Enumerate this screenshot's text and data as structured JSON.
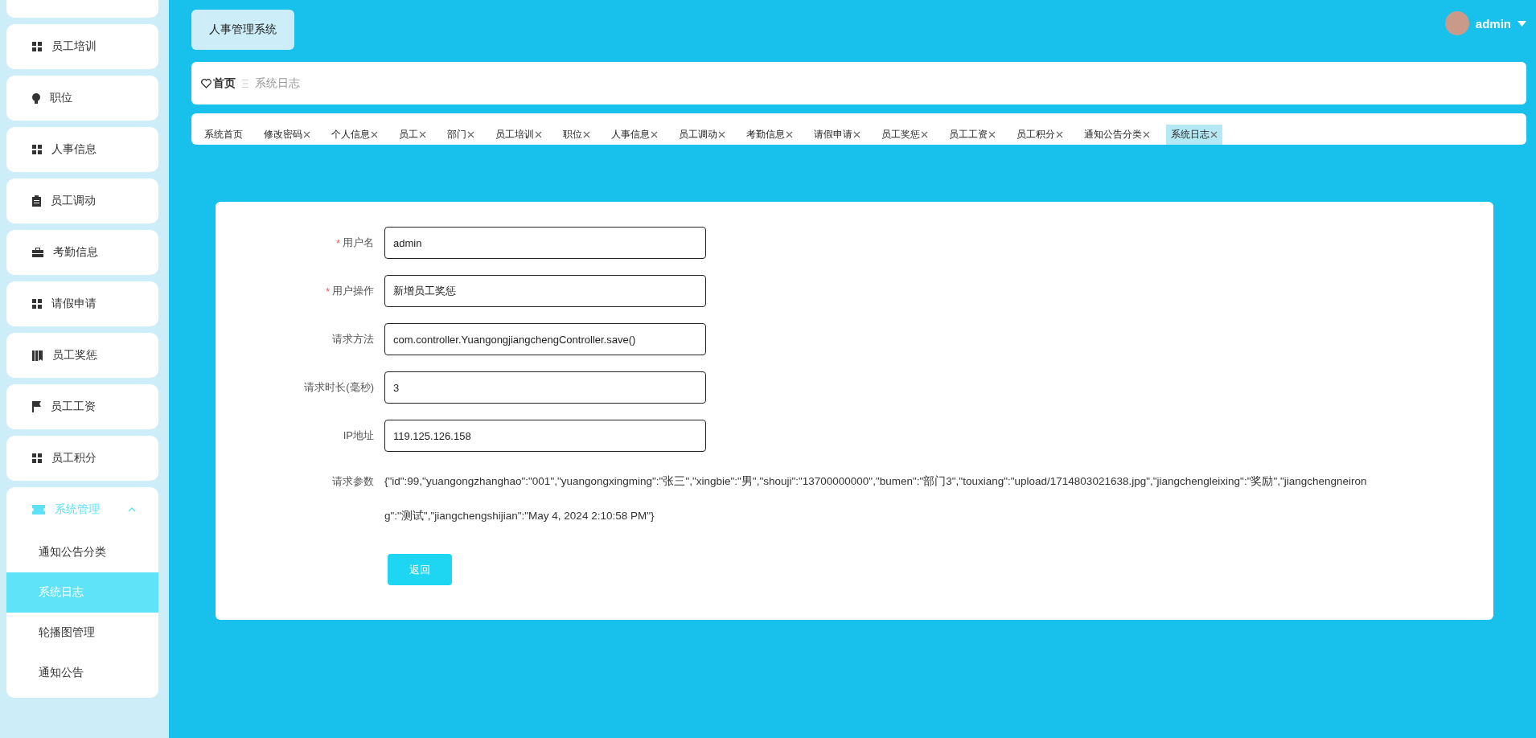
{
  "sidebar": {
    "items": [
      {
        "label": "员工培训",
        "kind": "grid"
      },
      {
        "label": "职位",
        "kind": "bulb"
      },
      {
        "label": "人事信息",
        "kind": "grid"
      },
      {
        "label": "员工调动",
        "kind": "clipboard"
      },
      {
        "label": "考勤信息",
        "kind": "briefcase"
      },
      {
        "label": "请假申请",
        "kind": "grid"
      },
      {
        "label": "员工奖惩",
        "kind": "book"
      },
      {
        "label": "员工工资",
        "kind": "flag"
      },
      {
        "label": "员工积分",
        "kind": "grid"
      }
    ],
    "group": {
      "label": "系统管理",
      "expanded": true,
      "children": [
        {
          "label": "通知公告分类",
          "selected": false
        },
        {
          "label": "系统日志",
          "selected": true
        },
        {
          "label": "轮播图管理",
          "selected": false
        },
        {
          "label": "通知公告",
          "selected": false
        }
      ]
    }
  },
  "header": {
    "title": "人事管理系统",
    "user": "admin"
  },
  "breadcrumb": {
    "home": "首页",
    "current": "系统日志"
  },
  "tabs": [
    {
      "label": "系统首页",
      "closable": false,
      "selected": false
    },
    {
      "label": "修改密码",
      "closable": true,
      "selected": false
    },
    {
      "label": "个人信息",
      "closable": true,
      "selected": false
    },
    {
      "label": "员工",
      "closable": true,
      "selected": false
    },
    {
      "label": "部门",
      "closable": true,
      "selected": false
    },
    {
      "label": "员工培训",
      "closable": true,
      "selected": false
    },
    {
      "label": "职位",
      "closable": true,
      "selected": false
    },
    {
      "label": "人事信息",
      "closable": true,
      "selected": false
    },
    {
      "label": "员工调动",
      "closable": true,
      "selected": false
    },
    {
      "label": "考勤信息",
      "closable": true,
      "selected": false
    },
    {
      "label": "请假申请",
      "closable": true,
      "selected": false
    },
    {
      "label": "员工奖惩",
      "closable": true,
      "selected": false
    },
    {
      "label": "员工工资",
      "closable": true,
      "selected": false
    },
    {
      "label": "员工积分",
      "closable": true,
      "selected": false
    },
    {
      "label": "通知公告分类",
      "closable": true,
      "selected": false
    },
    {
      "label": "系统日志",
      "closable": true,
      "selected": true
    }
  ],
  "form": {
    "fields": [
      {
        "label": "用户名",
        "required_mark": "*",
        "value": "admin"
      },
      {
        "label": "用户操作",
        "required_mark": "*",
        "value": "新增员工奖惩"
      },
      {
        "label": "请求方法",
        "value": "com.controller.YuangongjiangchengController.save()"
      },
      {
        "label": "请求时长(毫秒)",
        "value": "3"
      },
      {
        "label": "IP地址",
        "value": "119.125.126.158"
      }
    ],
    "params": {
      "label": "请求参数",
      "value": "{\"id\":99,\"yuangongzhanghao\":\"001\",\"yuangongxingming\":\"张三\",\"xingbie\":\"男\",\"shouji\":\"13700000000\",\"bumen\":\"部门3\",\"touxiang\":\"upload/1714803021638.jpg\",\"jiangchengleixing\":\"奖励\",\"jiangchengneirong\":\"测试\",\"jiangchengshijian\":\"May 4, 2024 2:10:58 PM\"}"
    },
    "back_button": "返回"
  }
}
